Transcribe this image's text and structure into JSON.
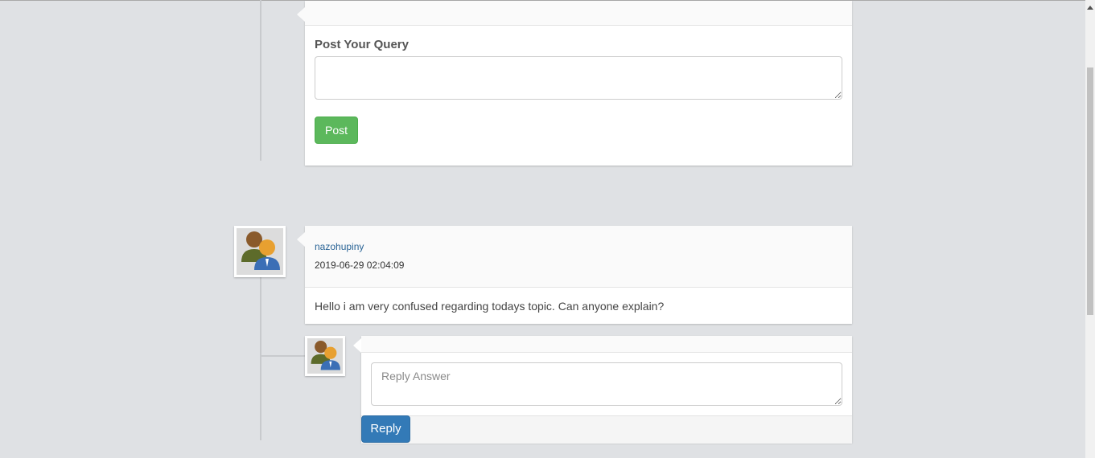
{
  "query_form": {
    "heading": "Post Your Query",
    "post_label": "Post"
  },
  "comment": {
    "username": "nazohupiny",
    "timestamp": "2019-06-29 02:04:09",
    "text": "Hello i am very confused regarding todays topic. Can anyone explain?"
  },
  "reply_form": {
    "placeholder": "Reply Answer",
    "reply_label": "Reply"
  },
  "icons": {
    "avatar": "users-avatar-icon",
    "scroll_up": "scroll-up-arrow-icon"
  },
  "colors": {
    "background": "#dfe1e4",
    "post_button": "#5cb85c",
    "reply_button": "#337ab7",
    "username_link": "#2a6496"
  }
}
